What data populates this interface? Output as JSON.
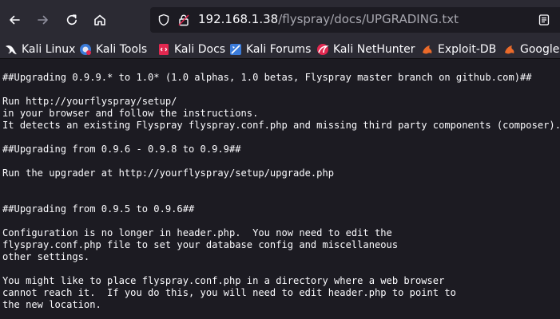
{
  "toolbar": {
    "back_icon": "arrow-left-icon",
    "forward_icon": "arrow-right-icon",
    "reload_icon": "reload-icon",
    "home_icon": "home-icon"
  },
  "urlbar": {
    "host": "192.168.1.38",
    "path": "/flyspray/docs/UPGRADING.txt"
  },
  "bookmarks": [
    {
      "label": "Kali Linux",
      "icon": "kali-dragon-icon"
    },
    {
      "label": "Kali Tools",
      "icon": "kali-tools-icon"
    },
    {
      "label": "Kali Docs",
      "icon": "kali-docs-icon"
    },
    {
      "label": "Kali Forums",
      "icon": "kali-forums-icon"
    },
    {
      "label": "Kali NetHunter",
      "icon": "nethunter-icon"
    },
    {
      "label": "Exploit-DB",
      "icon": "exploit-db-icon"
    },
    {
      "label": "Google Hacking DB",
      "icon": "ghdb-icon"
    }
  ],
  "document": {
    "lines": [
      "##Upgrading 0.9.9.* to 1.0* (1.0 alphas, 1.0 betas, Flyspray master branch on github.com)##",
      "",
      "Run http://yourflyspray/setup/",
      "in your browser and follow the instructions.",
      "It detects an existing Flyspray flyspray.conf.php and missing third party components (composer).",
      "",
      "##Upgrading from 0.9.6 - 0.9.8 to 0.9.9##",
      "",
      "Run the upgrader at http://yourflyspray/setup/upgrade.php",
      "",
      "",
      "##Upgrading from 0.9.5 to 0.9.6##",
      "",
      "Configuration is no longer in header.php.  You now need to edit the",
      "flyspray.conf.php file to set your database config and miscellaneous",
      "other settings.",
      "",
      "You might like to place flyspray.conf.php in a directory where a web browser",
      "cannot reach it.  If you do this, you will need to edit header.php to point to",
      "the new location."
    ]
  }
}
